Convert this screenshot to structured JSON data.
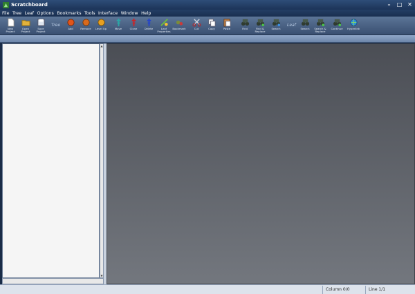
{
  "window": {
    "title": "Scratchboard",
    "minimize": "–",
    "maximize": "□",
    "close": "✕"
  },
  "menu": [
    "File",
    "Tree",
    "Leaf",
    "Options",
    "Bookmarks",
    "Tools",
    "Interface",
    "Window",
    "Help"
  ],
  "toolbar": {
    "sections": {
      "tree": "Tree",
      "leaf": "Leaf"
    },
    "buttons": [
      {
        "label": "New\nProject",
        "icon": "new-document-icon"
      },
      {
        "label": "Open\nProject",
        "icon": "open-folder-icon"
      },
      {
        "label": "Save\nProject",
        "icon": "save-icon"
      },
      {
        "label": "Add",
        "icon": "add-circle-icon"
      },
      {
        "label": "Remove",
        "icon": "remove-circle-icon"
      },
      {
        "label": "Level Up",
        "icon": "level-up-icon"
      },
      {
        "label": "Move",
        "icon": "move-node-icon"
      },
      {
        "label": "Clone",
        "icon": "clone-node-icon"
      },
      {
        "label": "Delete",
        "icon": "delete-node-icon"
      },
      {
        "label": "Leaf\nProperties",
        "icon": "leaf-properties-icon"
      },
      {
        "label": "Bookmark",
        "icon": "bookmark-icon"
      },
      {
        "label": "Cut",
        "icon": "scissors-icon"
      },
      {
        "label": "Copy",
        "icon": "copy-icon"
      },
      {
        "label": "Paste",
        "icon": "paste-icon"
      },
      {
        "label": "Find",
        "icon": "binoculars-icon"
      },
      {
        "label": "Find &\nReplace",
        "icon": "binoculars-replace-icon"
      },
      {
        "label": "Search",
        "icon": "binoculars-search-icon"
      },
      {
        "label": "Search",
        "icon": "binoculars-search-icon"
      },
      {
        "label": "Search &\nReplace",
        "icon": "binoculars-replace-icon"
      },
      {
        "label": "Continue",
        "icon": "binoculars-continue-icon"
      },
      {
        "label": "Hyperlink",
        "icon": "hyperlink-globe-icon"
      }
    ]
  },
  "statusbar": {
    "column": "Column 0/0",
    "line": "Line 1/1"
  },
  "scrollbar": {
    "up": "▲",
    "down": "▼",
    "left": "◀",
    "right": "▶"
  }
}
